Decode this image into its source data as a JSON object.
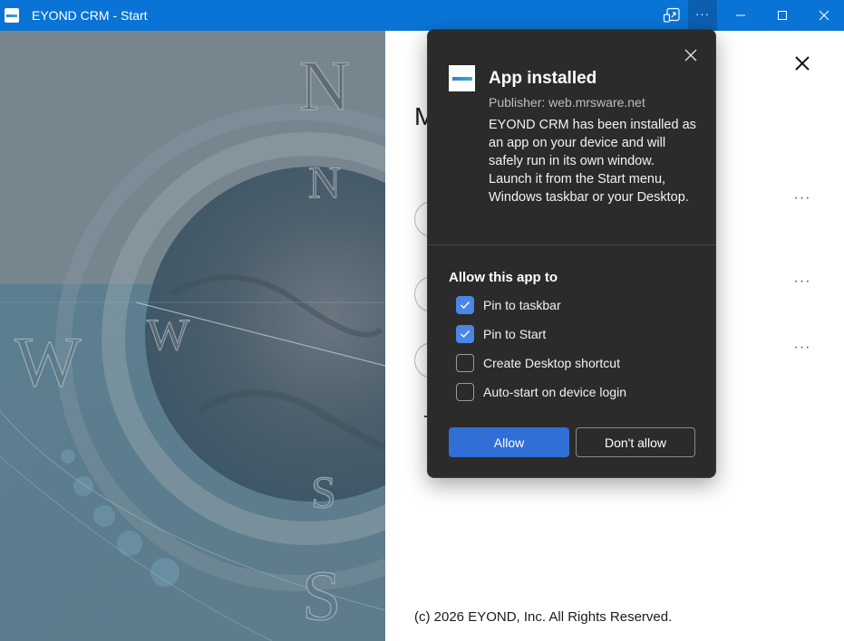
{
  "window": {
    "title": "EYOND CRM - Start",
    "more_label": "···"
  },
  "main": {
    "heading": "M",
    "footer": "(c) 2026 EYOND, Inc. All Rights Reserved.",
    "row_more_label": "···"
  },
  "art": {
    "letters": [
      "N",
      "N",
      "W",
      "W",
      "S",
      "S"
    ]
  },
  "popup": {
    "title": "App installed",
    "publisher": "Publisher: web.mrsware.net",
    "description": "EYOND CRM has been installed as an app on your device and will safely run in its own window. Launch it from the Start menu, Windows taskbar or your Desktop.",
    "allow_heading": "Allow this app to",
    "options": [
      {
        "label": "Pin to taskbar",
        "checked": true
      },
      {
        "label": "Pin to Start",
        "checked": true
      },
      {
        "label": "Create Desktop shortcut",
        "checked": false
      },
      {
        "label": "Auto-start on device login",
        "checked": false
      }
    ],
    "allow_button": "Allow",
    "deny_button": "Don't allow"
  },
  "colors": {
    "titlebar": "#0a74d6",
    "popup_bg": "#2b2b2b",
    "accent": "#2f6fd6"
  }
}
